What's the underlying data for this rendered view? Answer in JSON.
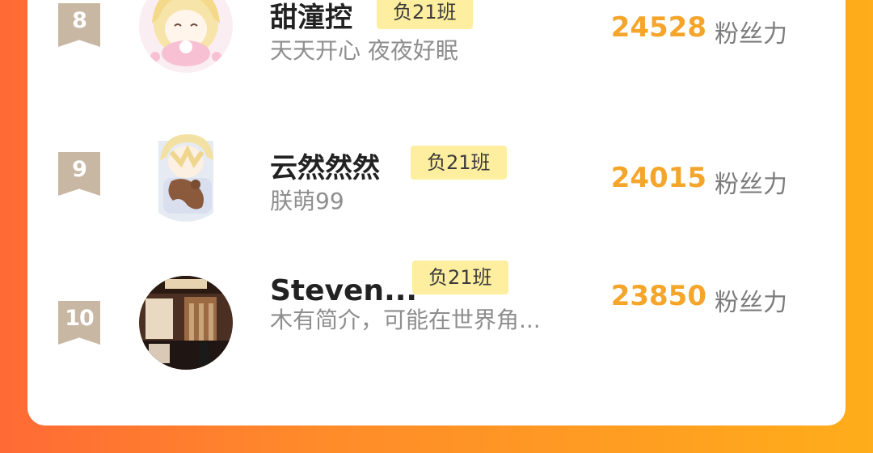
{
  "ranking": {
    "rows": [
      {
        "rank": "8",
        "name": "甜潼控",
        "class_tag": "负21班",
        "bio": "天天开心 夜夜好眠",
        "fans": "24528",
        "fans_label": "粉丝力",
        "avatar": "anime-girl-pink-avatar"
      },
      {
        "rank": "9",
        "name": "云然然然",
        "class_tag": "负21班",
        "bio": "朕萌99",
        "fans": "24015",
        "fans_label": "粉丝力",
        "avatar": "anime-boy-blonde-avatar"
      },
      {
        "rank": "10",
        "name": "Steven...",
        "class_tag": "负21班",
        "bio": "木有简介，可能在世界角...",
        "fans": "23850",
        "fans_label": "粉丝力",
        "avatar": "restaurant-interior-avatar"
      }
    ]
  },
  "colors": {
    "background_gradient_start": "#ff6a35",
    "background_gradient_end": "#ffad1a",
    "card": "#ffffff",
    "rank_badge": "#c8b7a3",
    "class_tag_bg": "#fdeea0",
    "fans_value": "#f5a52a",
    "name_text": "#222222",
    "bio_text": "#8e8e8e"
  }
}
